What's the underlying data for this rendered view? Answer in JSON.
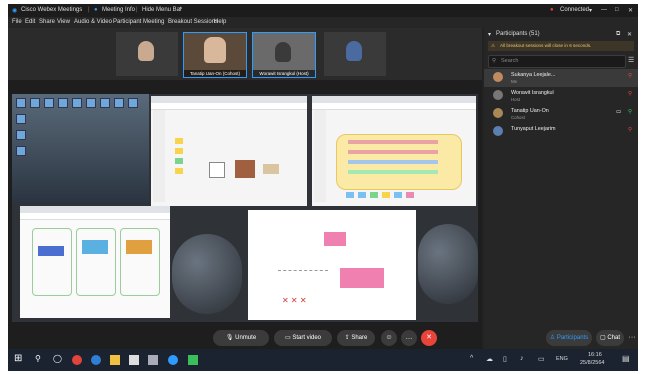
{
  "window": {
    "app_title": "Cisco Webex Meetings",
    "meeting_info": "Meeting Info",
    "hide_menu": "Hide Menu Bar",
    "status": "Connected",
    "win_controls": [
      "—",
      "□",
      "✕"
    ]
  },
  "menu": [
    "File",
    "Edit",
    "Share",
    "View",
    "Audio & Video",
    "Participant",
    "Meeting",
    "Breakout Sessions",
    "Help"
  ],
  "thumbnails": [
    {
      "name": "",
      "color": "#2a2a2a"
    },
    {
      "name": "Tanatip Uan-On (Cohost)",
      "color": "#4a3c30"
    },
    {
      "name": "Worawit Israngkul (Host)",
      "color": "#5a5a5a"
    },
    {
      "name": "",
      "color": "#2a2a2a"
    }
  ],
  "sidebar": {
    "title": "Participants (51)",
    "warning": "All breakout sessions will close in 6 seconds.",
    "search_placeholder": "Search",
    "participants": [
      {
        "name": "Sukanya Leejale...",
        "role": "Me",
        "color": "#c08a60"
      },
      {
        "name": "Worawit Israngkul",
        "role": "Host",
        "color": "#777"
      },
      {
        "name": "Tanatip Uan-On",
        "role": "Cohost",
        "color": "#a85"
      },
      {
        "name": "Tunyaput Leejarim",
        "role": "",
        "color": "#5b7fb0"
      }
    ]
  },
  "controls": {
    "unmute": "Unmute",
    "start_video": "Start video",
    "share": "Share",
    "participants": "Participants",
    "chat": "Chat",
    "more": "···"
  },
  "taskbar": {
    "lang": "ENG",
    "time": "16:16",
    "date": "25/8/2564"
  },
  "colors": {
    "accent": "#2e9cff",
    "end_call": "#e8443a",
    "warning": "#e7c46b"
  }
}
